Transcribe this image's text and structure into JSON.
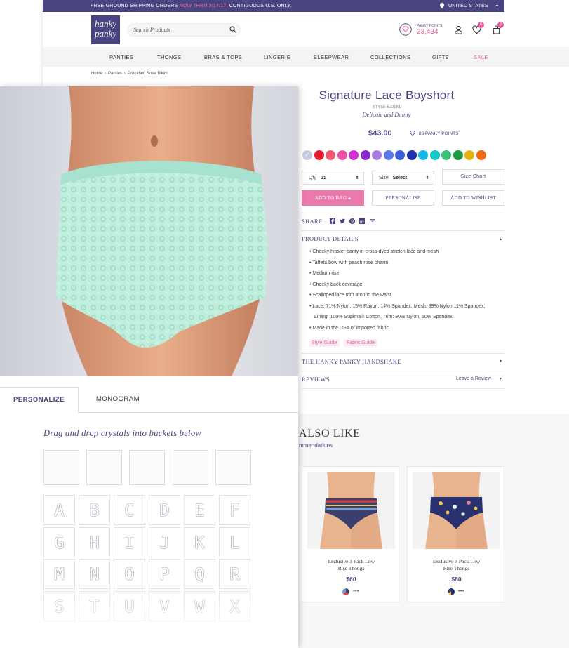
{
  "promo": {
    "text_before": "FREE GROUND SHIPPING ORDERS ",
    "highlight": "NOW THRU 2/14/17!",
    "text_after": " CONTIGUOUS U.S. ONLY.",
    "country": "UNITED STATES"
  },
  "header": {
    "logo_line1": "hanky",
    "logo_line2": "panky",
    "search_placeholder": "Search Products",
    "points_label": "PANKY POINTS",
    "points_value": "23,434",
    "wishlist_count": "0",
    "bag_count": "0"
  },
  "nav": [
    "PANTIES",
    "THONGS",
    "BRAS & TOPS",
    "LINGERIE",
    "SLEEPWEAR",
    "COLLECTIONS",
    "GIFTS",
    "SALE"
  ],
  "breadcrumb": [
    "Home",
    "›",
    "Panties",
    "›",
    "Porcelain Rose Bikini"
  ],
  "product": {
    "title": "Signature Lace Boyshort",
    "style": "STYLE 5J2181",
    "subtitle": "Delicate and Dainty",
    "price": "$43.00",
    "points": "86 PANKY POINTS",
    "swatches": [
      "#c7cbe0",
      "#e81a2e",
      "#ef5a6f",
      "#ee4fa6",
      "#d12fd0",
      "#8a2bc9",
      "#a97ee0",
      "#5d79e6",
      "#3d5fdc",
      "#1f2fae",
      "#10b7e6",
      "#17c9c9",
      "#39c07a",
      "#1e9a3e",
      "#e4b30f",
      "#ef6a14"
    ],
    "qty_label": "Qty",
    "qty_value": "01",
    "size_label": "Size",
    "size_value": "Select",
    "size_chart": "Size Chart",
    "add_to_bag": "ADD TO BAG",
    "personalise": "PERSONALISE",
    "wishlist": "ADD TO WISHLIST",
    "share": "SHARE",
    "details_title": "PRODUCT DETAILS",
    "details": [
      "Cheeky hipster panty in cross-dyed stretch lace and mesh",
      "Taffeta bow with peach rose charm",
      "Medium rise",
      "Cheeky back coverage",
      "Scalloped lace trim around the waist",
      "Lace: 71% Nylon, 15% Rayon, 14% Spandex, Mesh: 89% Nylon 11% Spandex;",
      "Lining: 100% Supima® Cotton, Trim: 90% Nylon, 10% Spandex.",
      "Made in the USA of imported fabric"
    ],
    "style_guide": "Style Guide",
    "fabric_guide": "Fabric Guide",
    "handshake": "THE HANKY PANKY HANDSHAKE",
    "reviews": "REVIEWS",
    "leave_review": "Leave a Review"
  },
  "recs": {
    "title": "ALSO LIKE",
    "subtitle": "mmendations",
    "items": [
      {
        "name_line1": "Exclusive 3 Pack Low",
        "name_line2": "Rise Thongs",
        "price": "$60",
        "more": "•••"
      },
      {
        "name_line1": "Exclusive 3 Pack Low",
        "name_line2": "Rise Thongs",
        "price": "$60",
        "more": "•••"
      }
    ]
  },
  "personalize": {
    "tab_active": "PERSONALIZE",
    "tab_other": "MONOGRAM",
    "instruction": "Drag and drop crystals into buckets below",
    "letters": [
      "A",
      "B",
      "C",
      "D",
      "E",
      "F",
      "G",
      "H",
      "I",
      "J",
      "K",
      "L",
      "M",
      "N",
      "O",
      "P",
      "Q",
      "R",
      "S",
      "T",
      "U",
      "V",
      "W",
      "X"
    ]
  },
  "colors": {
    "brand": "#4a4480",
    "accent": "#e85c9b",
    "hero_lace": "#b8ecd9"
  }
}
